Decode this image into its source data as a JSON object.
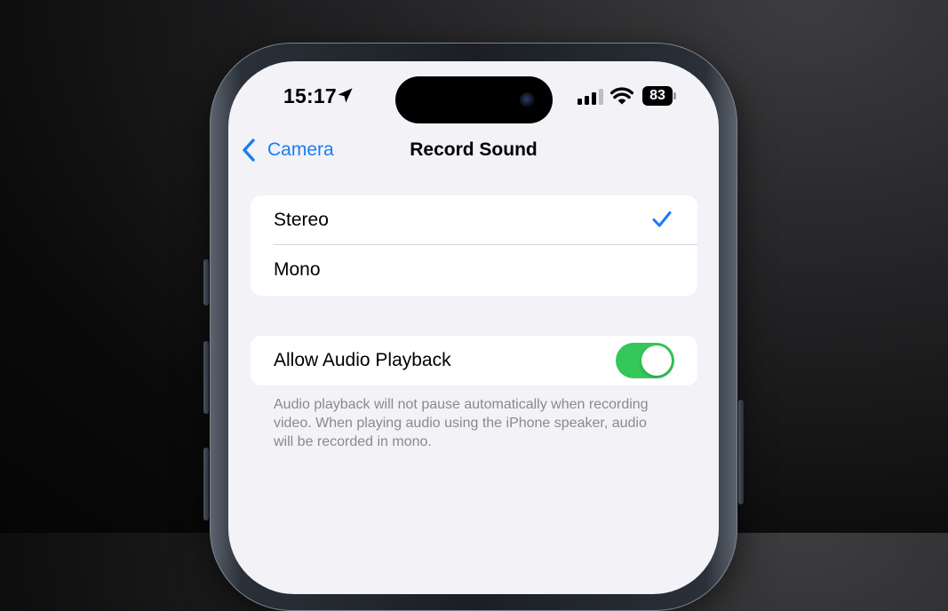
{
  "status_bar": {
    "time": "15:17",
    "location_icon": "location-arrow-icon",
    "signal_icon": "cellular-signal-icon",
    "wifi_icon": "wifi-icon",
    "battery_level": "83",
    "battery_icon": "battery-icon"
  },
  "nav": {
    "back_label": "Camera",
    "back_icon": "chevron-left-icon",
    "title": "Record Sound"
  },
  "options": {
    "items": [
      {
        "label": "Stereo",
        "selected": true
      },
      {
        "label": "Mono",
        "selected": false
      }
    ],
    "selected_icon": "checkmark-icon"
  },
  "audio_playback": {
    "label": "Allow Audio Playback",
    "enabled": true,
    "footnote": "Audio playback will not pause automatically when recording video. When playing audio using the iPhone speaker, audio will be recorded in mono."
  },
  "colors": {
    "accent": "#1a7cf5",
    "toggle_on": "#34c759",
    "background": "#f2f2f7",
    "footnote": "#8a8a8e"
  }
}
